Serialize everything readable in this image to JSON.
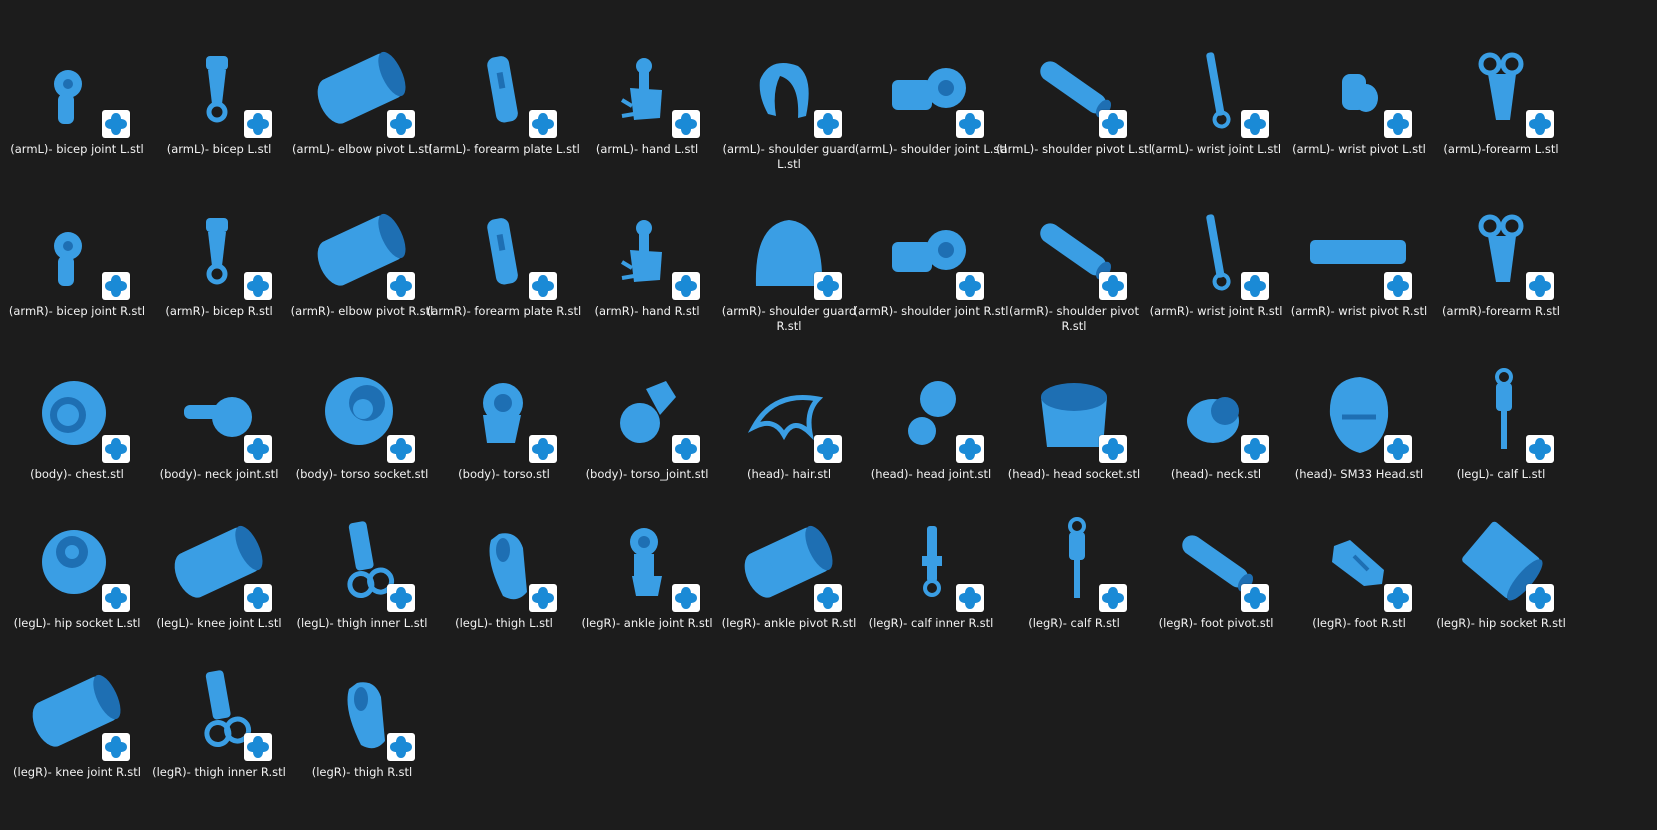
{
  "colors": {
    "background": "#1c1c1c",
    "model": "#3a9ee4",
    "model_shade": "#1e6fb3",
    "badge": "#ffffff",
    "badge_icon": "#1a8ad6",
    "label": "#f2f2f2"
  },
  "files": [
    {
      "label": "(armL)- bicep joint L.stl",
      "icon": "ring-joint-icon"
    },
    {
      "label": "(armL)- bicep L.stl",
      "icon": "bicep-icon"
    },
    {
      "label": "(armL)- elbow pivot L.stl",
      "icon": "cylinder-icon"
    },
    {
      "label": "(armL)- forearm plate L.stl",
      "icon": "plate-icon"
    },
    {
      "label": "(armL)- hand L.stl",
      "icon": "hand-icon"
    },
    {
      "label": "(armL)- shoulder guard L.stl",
      "icon": "guard-icon"
    },
    {
      "label": "(armL)- shoulder joint L.stl",
      "icon": "shoulder-joint-icon"
    },
    {
      "label": "(armL)- shoulder pivot L.stl",
      "icon": "rod-icon"
    },
    {
      "label": "(armL)- wrist joint L.stl",
      "icon": "wrist-joint-icon"
    },
    {
      "label": "(armL)- wrist pivot L.stl",
      "icon": "short-cylinder-icon"
    },
    {
      "label": "(armL)-forearm L.stl",
      "icon": "forearm-icon"
    },
    {
      "label": "(armR)- bicep joint R.stl",
      "icon": "ring-joint-icon"
    },
    {
      "label": "(armR)- bicep R.stl",
      "icon": "bicep-icon"
    },
    {
      "label": "(armR)- elbow pivot R.stl",
      "icon": "cylinder-icon"
    },
    {
      "label": "(armR)- forearm plate R.stl",
      "icon": "plate-icon"
    },
    {
      "label": "(armR)- hand R.stl",
      "icon": "hand-icon"
    },
    {
      "label": "(armR)- shoulder guard R.stl",
      "icon": "dome-icon"
    },
    {
      "label": "(armR)- shoulder joint R.stl",
      "icon": "shoulder-joint-icon"
    },
    {
      "label": "(armR)- shoulder pivot R.stl",
      "icon": "rod-icon"
    },
    {
      "label": "(armR)- wrist joint R.stl",
      "icon": "wrist-joint-icon"
    },
    {
      "label": "(armR)- wrist pivot R.stl",
      "icon": "flat-rod-icon"
    },
    {
      "label": "(armR)-forearm R.stl",
      "icon": "forearm-icon"
    },
    {
      "label": "(body)- chest.stl",
      "icon": "chest-icon"
    },
    {
      "label": "(body)- neck joint.stl",
      "icon": "ball-joint-icon"
    },
    {
      "label": "(body)- torso socket.stl",
      "icon": "socket-icon"
    },
    {
      "label": "(body)- torso.stl",
      "icon": "torso-icon"
    },
    {
      "label": "(body)- torso_joint.stl",
      "icon": "hex-joint-icon"
    },
    {
      "label": "(head)- hair.stl",
      "icon": "hair-icon"
    },
    {
      "label": "(head)- head joint.stl",
      "icon": "double-ball-icon"
    },
    {
      "label": "(head)- head socket.stl",
      "icon": "cup-icon"
    },
    {
      "label": "(head)- neck.stl",
      "icon": "neck-icon"
    },
    {
      "label": "(head)- SM33 Head.stl",
      "icon": "head-icon"
    },
    {
      "label": "(legL)- calf L.stl",
      "icon": "calf-icon"
    },
    {
      "label": "(legL)- hip socket L.stl",
      "icon": "hip-socket-icon"
    },
    {
      "label": "(legL)- knee joint L.stl",
      "icon": "cylinder-icon"
    },
    {
      "label": "(legL)- thigh inner L.stl",
      "icon": "thigh-inner-icon"
    },
    {
      "label": "(legL)- thigh L.stl",
      "icon": "thigh-icon"
    },
    {
      "label": "(legR)- ankle joint R.stl",
      "icon": "ankle-joint-icon"
    },
    {
      "label": "(legR)- ankle pivot R.stl",
      "icon": "cylinder-icon"
    },
    {
      "label": "(legR)- calf inner R.stl",
      "icon": "calf-inner-icon"
    },
    {
      "label": "(legR)- calf R.stl",
      "icon": "calf-icon"
    },
    {
      "label": "(legR)- foot pivot.stl",
      "icon": "rod-icon"
    },
    {
      "label": "(legR)- foot R.stl",
      "icon": "foot-icon"
    },
    {
      "label": "(legR)- hip socket R.stl",
      "icon": "barrel-icon"
    },
    {
      "label": "(legR)- knee joint R.stl",
      "icon": "cylinder-icon"
    },
    {
      "label": "(legR)- thigh inner R.stl",
      "icon": "thigh-inner-icon"
    },
    {
      "label": "(legR)- thigh R.stl",
      "icon": "thigh-icon"
    }
  ]
}
